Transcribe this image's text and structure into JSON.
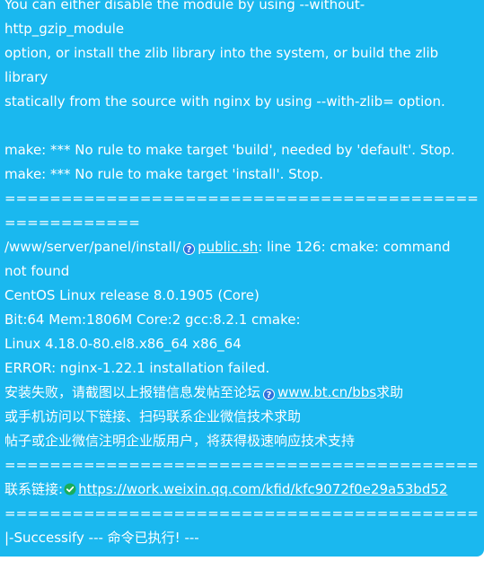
{
  "lines": {
    "l1": "You can either disable the module by using --without-",
    "l2": "http_gzip_module",
    "l3": "option, or install the zlib library into the system, or build the zlib",
    "l4": "library",
    "l5": "statically from the source with nginx by using --with-zlib= option.",
    "l6": "",
    "l7": "make: *** No rule to make target 'build', needed by 'default'. Stop.",
    "l8": "make: *** No rule to make target 'install'. Stop.",
    "rule1a": "==========================================",
    "rule1b": "============",
    "l10_prefix": "/www/server/panel/install/",
    "l10_link": "public.sh",
    "l10_suffix": ": line 126: cmake: command",
    "l11": "not found",
    "l12": "CentOS Linux release 8.0.1905 (Core)",
    "l13": "Bit:64 Mem:1806M Core:2 gcc:8.2.1 cmake:",
    "l14": "Linux 4.18.0-80.el8.x86_64 x86_64",
    "l15": "ERROR: nginx-1.22.1 installation failed.",
    "l16_prefix": "安装失败，请截图以上报错信息发帖至论坛",
    "l16_link": "www.bt.cn/bbs",
    "l16_suffix": "求助",
    "l17": "或手机访问以下链接、扫码联系企业微信技术求助",
    "l18": "帖子或企业微信注明企业版用户，将获得极速响应技术支持",
    "rule2": "==========================================",
    "l20_prefix": "联系链接:",
    "l20_link": "https://work.weixin.qq.com/kfid/kfc9072f0e29a53bd52",
    "rule3": "==========================================",
    "l22": "|-Successify --- 命令已执行! ---"
  },
  "icons": {
    "help": "question-circle-icon",
    "verified": "verified-check-icon"
  },
  "colors": {
    "bubble": "#1ab8ef",
    "text": "#ffffff",
    "help_icon": "#2f6fdb",
    "verified_icon": "#1aad5b"
  }
}
